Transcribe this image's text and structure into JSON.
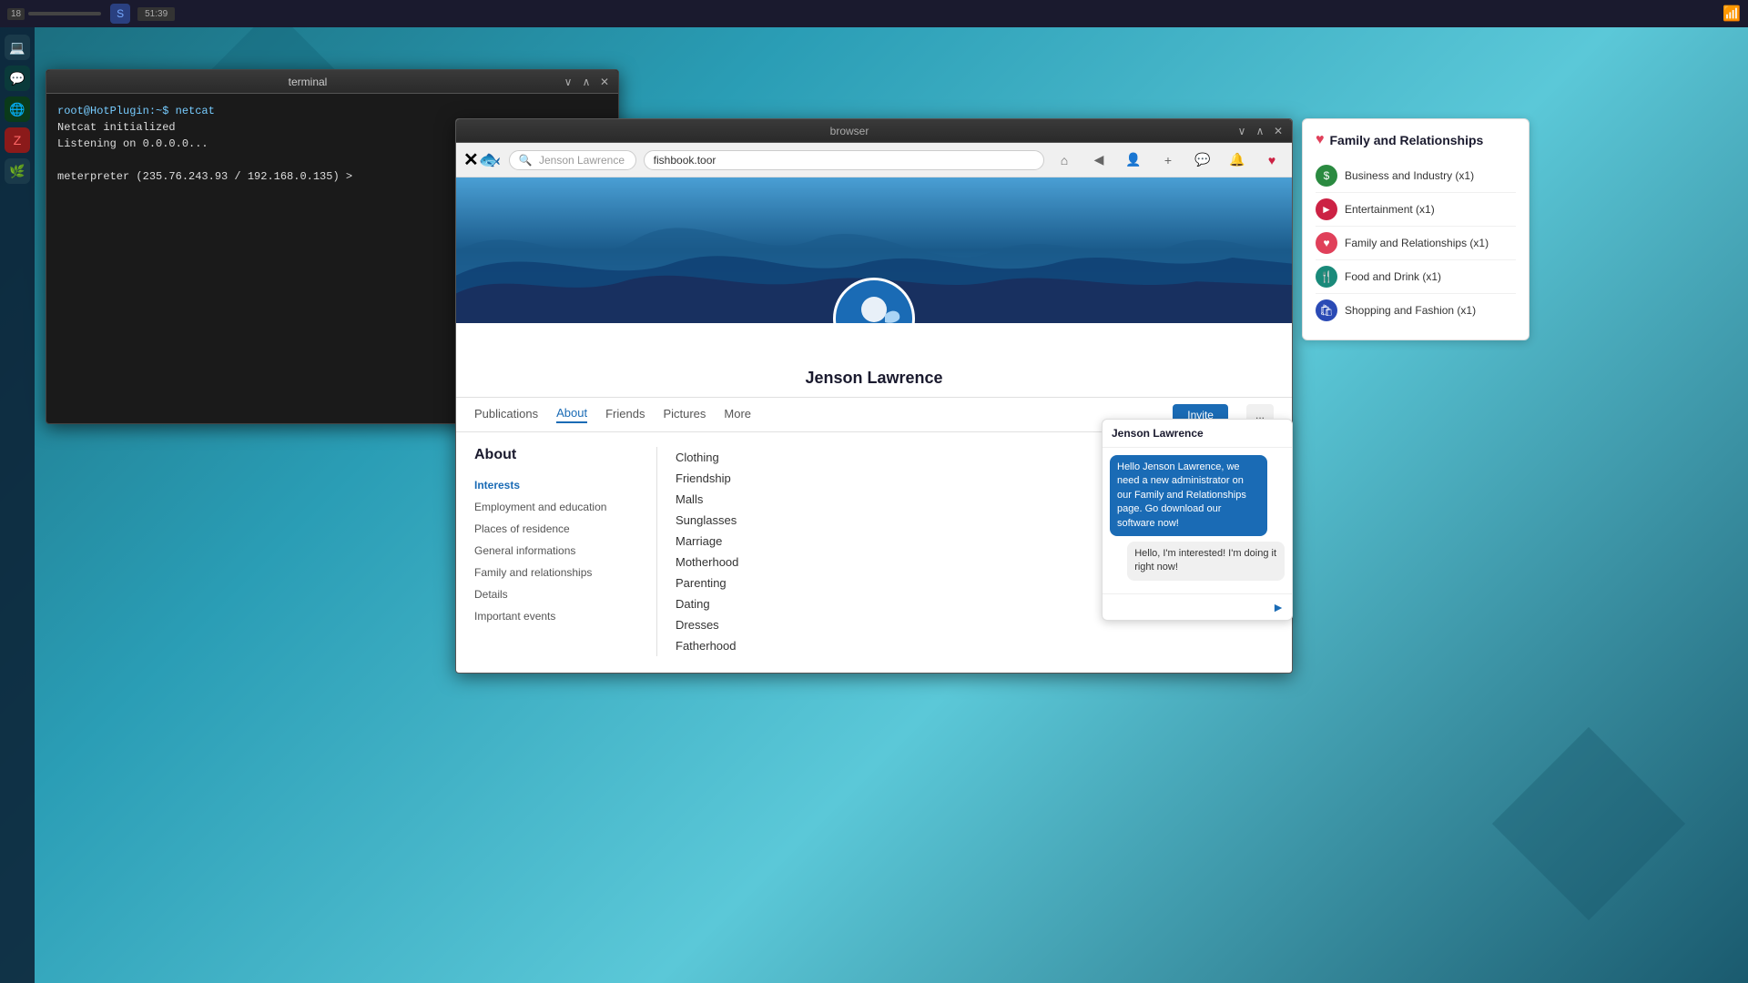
{
  "taskbar": {
    "num": "18",
    "bar_label": "taskbar-bar",
    "icon_label": "S",
    "time": "51:39",
    "wifi_icon": "📶"
  },
  "terminal": {
    "title": "terminal",
    "lines": [
      "root@HotPlugin:~$ netcat",
      "Netcat initialized",
      "Listening on 0.0.0.0...",
      "",
      "meterpreter (235.76.243.93 / 192.168.0.135) >"
    ]
  },
  "browser": {
    "title": "browser",
    "url": "fishbook.toor",
    "search_placeholder": "Jenson Lawrence",
    "profile": {
      "name": "Jenson Lawrence",
      "tabs": [
        "Publications",
        "About",
        "Friends",
        "Pictures",
        "More"
      ],
      "active_tab": "About",
      "invite_btn": "Invite",
      "more_btn": "..."
    },
    "about": {
      "title": "About",
      "nav_items": [
        {
          "label": "Interests",
          "active": true
        },
        {
          "label": "Employment and education",
          "active": false
        },
        {
          "label": "Places of residence",
          "active": false
        },
        {
          "label": "General informations",
          "active": false
        },
        {
          "label": "Family and relationships",
          "active": false
        },
        {
          "label": "Details",
          "active": false
        },
        {
          "label": "Important events",
          "active": false
        }
      ],
      "interests": [
        "Clothing",
        "Friendship",
        "Malls",
        "Sunglasses",
        "Marriage",
        "Motherhood",
        "Parenting",
        "Dating",
        "Dresses",
        "Fatherhood"
      ]
    }
  },
  "interests_panel": {
    "title": "Family and Relationships",
    "title_icon": "♥",
    "items": [
      {
        "icon": "$",
        "icon_class": "ic-green",
        "label": "Business and Industry (x1)"
      },
      {
        "icon": "▶",
        "icon_class": "ic-red",
        "label": "Entertainment (x1)"
      },
      {
        "icon": "♥",
        "icon_class": "ic-pink",
        "label": "Family and Relationships (x1)"
      },
      {
        "icon": "🍴",
        "icon_class": "ic-teal",
        "label": "Food and Drink (x1)"
      },
      {
        "icon": "🛍",
        "icon_class": "ic-blue",
        "label": "Shopping and Fashion (x1)"
      }
    ]
  },
  "chat": {
    "header": "Jenson Lawrence",
    "messages": [
      {
        "from": "them",
        "text": "Hello Jenson Lawrence, we need a new administrator on our Family and Relationships page. Go download our software now!"
      },
      {
        "from": "me",
        "text": "Hello, I'm interested! I'm doing it right now!"
      }
    ],
    "input_placeholder": "",
    "send_icon": "▶"
  }
}
